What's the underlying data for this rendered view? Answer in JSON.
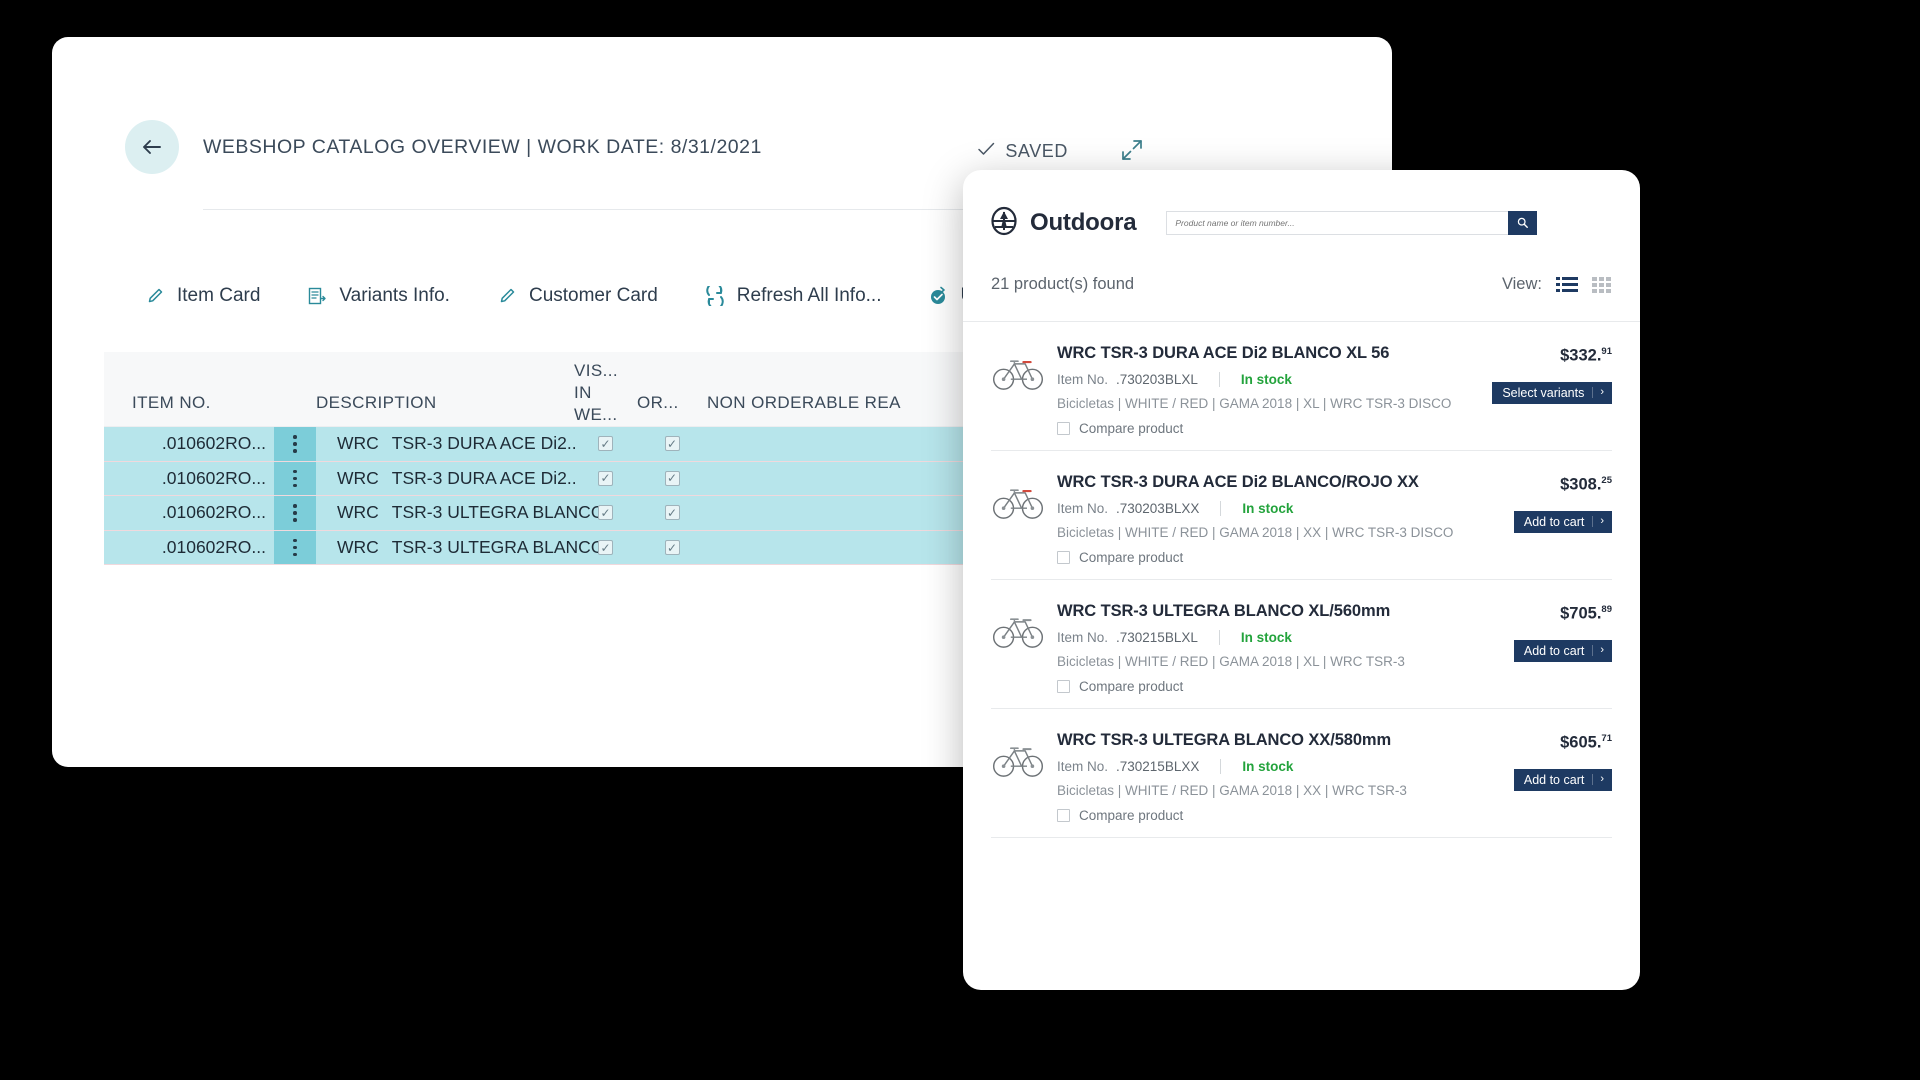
{
  "erp": {
    "back_icon": "arrow-left-icon",
    "title": "WEBSHOP CATALOG OVERVIEW | WORK DATE: 8/31/2021",
    "status": "SAVED",
    "status_icon": "check-icon",
    "expand_icon": "expand-diagonal-icon",
    "toolbar": [
      {
        "label": "Item Card",
        "icon": "pencil-icon"
      },
      {
        "label": "Variants Info.",
        "icon": "list-document-icon"
      },
      {
        "label": "Customer Card",
        "icon": "pencil-icon"
      },
      {
        "label": "Refresh All Info...",
        "icon": "refresh-icon"
      },
      {
        "label": "Updat",
        "icon": "update-check-icon"
      }
    ],
    "table": {
      "headers": {
        "item_no": "ITEM NO.",
        "description": "DESCRIPTION",
        "visible_in_web": "VIS...\nIN\nWE...",
        "orderable": "OR...",
        "non_orderable_reason": "NON ORDERABLE REA"
      },
      "rows": [
        {
          "item_no": ".010602RO...",
          "code": "WRC",
          "description": "TSR-3 DURA ACE Di2..",
          "visible": true,
          "orderable": true,
          "non_orderable_reason": ""
        },
        {
          "item_no": ".010602RO...",
          "code": "WRC",
          "description": "TSR-3 DURA ACE Di2..",
          "visible": true,
          "orderable": true,
          "non_orderable_reason": ""
        },
        {
          "item_no": ".010602RO...",
          "code": "WRC",
          "description": "TSR-3 ULTEGRA BLANCO..",
          "visible": true,
          "orderable": true,
          "non_orderable_reason": ""
        },
        {
          "item_no": ".010602RO...",
          "code": "WRC",
          "description": "TSR-3 ULTEGRA BLANCO..",
          "visible": true,
          "orderable": true,
          "non_orderable_reason": ""
        }
      ],
      "checkbox_glyph": "✓"
    }
  },
  "shop": {
    "brand": "Outdoora",
    "brand_icon": "outdoora-globe-tree-logo",
    "search": {
      "placeholder": "Product name or item number...",
      "value": "",
      "button_icon": "search-icon"
    },
    "result_count": "21 product(s) found",
    "view_label": "View:",
    "view_list_icon": "list-view-icon",
    "view_grid_icon": "grid-view-icon",
    "view_active": "list",
    "item_no_label": "Item No.",
    "compare_label": "Compare product",
    "products": [
      {
        "title": "WRC TSR-3 DURA ACE Di2 BLANCO XL 56",
        "item_no": ".730203BLXL",
        "stock": "In stock",
        "categories": "Bicicletas | WHITE / RED | GAMA 2018 | XL | WRC TSR-3 DISCO",
        "price_main": "$332.",
        "price_cents": "91",
        "button": "Select variants",
        "thumb_icon": "bicycle-thumbnail"
      },
      {
        "title": "WRC TSR-3 DURA ACE Di2 BLANCO/ROJO XX",
        "item_no": ".730203BLXX",
        "stock": "In stock",
        "categories": "Bicicletas | WHITE / RED | GAMA 2018 | XX | WRC TSR-3 DISCO",
        "price_main": "$308.",
        "price_cents": "25",
        "button": "Add to cart",
        "thumb_icon": "bicycle-thumbnail"
      },
      {
        "title": "WRC TSR-3 ULTEGRA BLANCO XL/560mm",
        "item_no": ".730215BLXL",
        "stock": "In stock",
        "categories": "Bicicletas | WHITE / RED | GAMA 2018 | XL | WRC TSR-3",
        "price_main": "$705.",
        "price_cents": "89",
        "button": "Add to cart",
        "thumb_icon": "bicycle-thumbnail"
      },
      {
        "title": "WRC TSR-3 ULTEGRA BLANCO XX/580mm",
        "item_no": ".730215BLXX",
        "stock": "In stock",
        "categories": "Bicicletas | WHITE / RED | GAMA 2018 | XX | WRC TSR-3",
        "price_main": "$605.",
        "price_cents": "71",
        "button": "Add to cart",
        "thumb_icon": "bicycle-thumbnail"
      }
    ]
  },
  "colors": {
    "brand_dark_blue": "#1e3a62",
    "teal_accent": "#2a8a9a",
    "row_highlight": "#b7e5eb",
    "row_handle": "#7ccdd9",
    "in_stock_green": "#23a33c",
    "back_circle": "#dceff1"
  }
}
